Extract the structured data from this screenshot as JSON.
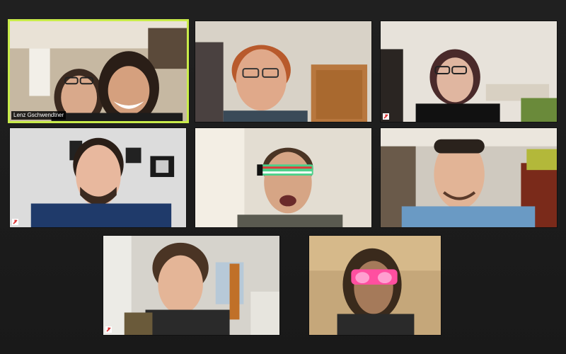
{
  "meeting": {
    "active_speaker_name": "Lenz Gschwendtner",
    "colors": {
      "active_border": "#c9ec4a",
      "background": "#1d1d1d",
      "mute": "#d33"
    }
  },
  "participants": [
    {
      "id": "p1",
      "label": "Lenz Gschwendtner",
      "active": true,
      "muted": false
    },
    {
      "id": "p2",
      "label": "",
      "active": false,
      "muted": false
    },
    {
      "id": "p3",
      "label": "",
      "active": false,
      "muted": true
    },
    {
      "id": "p4",
      "label": "",
      "active": false,
      "muted": true
    },
    {
      "id": "p5",
      "label": "",
      "active": false,
      "muted": false
    },
    {
      "id": "p6",
      "label": "",
      "active": false,
      "muted": false
    },
    {
      "id": "p7",
      "label": "",
      "active": false,
      "muted": true
    },
    {
      "id": "p8",
      "label": "",
      "active": false,
      "muted": false
    }
  ]
}
